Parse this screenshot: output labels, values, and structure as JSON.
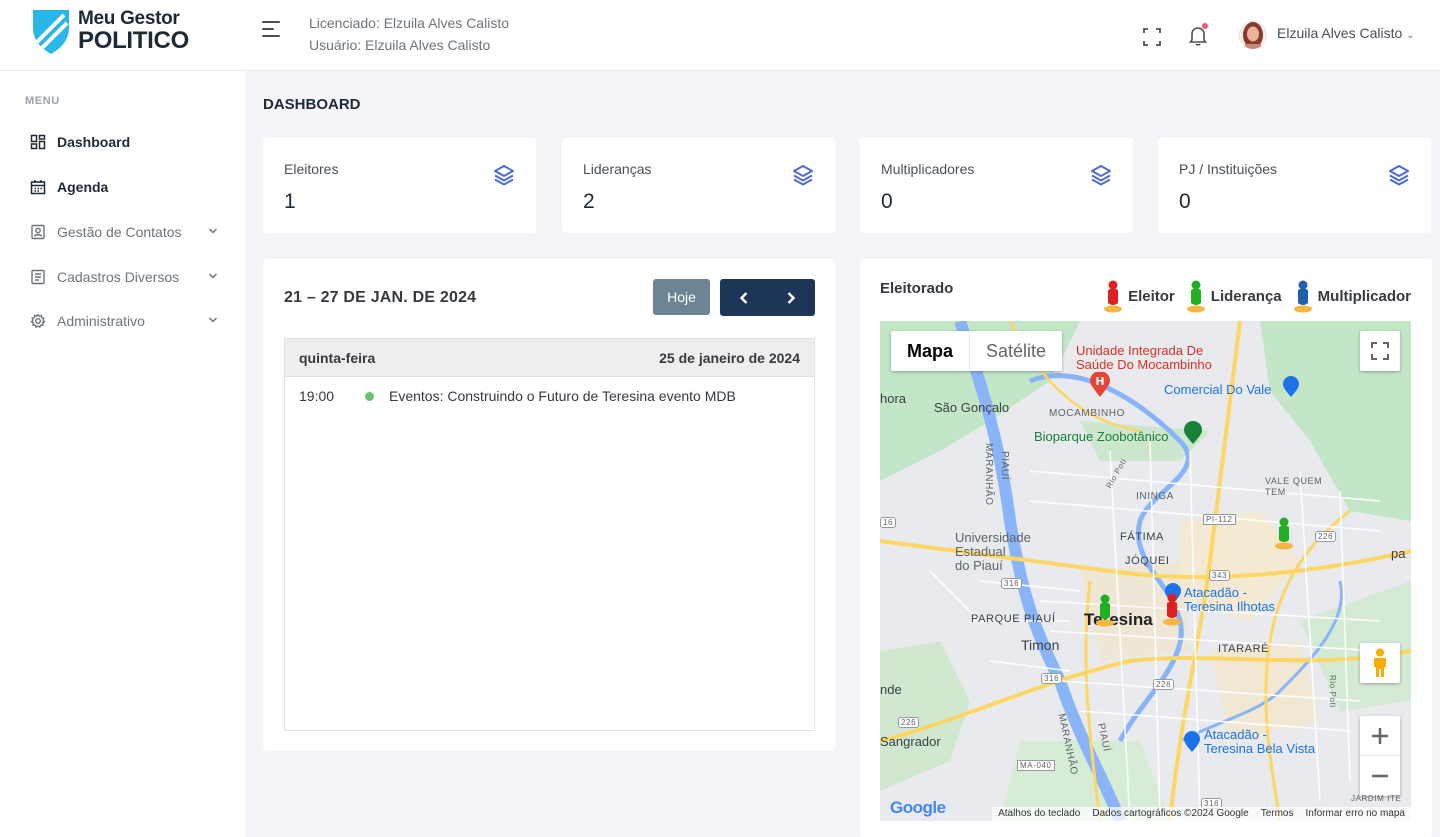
{
  "app": {
    "logo_line1": "Meu Gestor",
    "logo_line2": "POLITICO"
  },
  "header": {
    "licensee": "Licenciado: Elzuila Alves Calisto",
    "user_line": "Usuário: Elzuila Alves Calisto",
    "user_name": "Elzuila Alves Calisto"
  },
  "sidebar": {
    "menu_title": "MENU",
    "items": [
      {
        "label": "Dashboard",
        "icon": "dashboard-icon"
      },
      {
        "label": "Agenda",
        "icon": "calendar-icon"
      },
      {
        "label": "Gestão de Contatos",
        "icon": "contacts-icon"
      },
      {
        "label": "Cadastros Diversos",
        "icon": "form-icon"
      },
      {
        "label": "Administrativo",
        "icon": "gear-icon"
      }
    ]
  },
  "page": {
    "title": "DASHBOARD"
  },
  "stats": [
    {
      "label": "Eleitores",
      "value": "1"
    },
    {
      "label": "Lideranças",
      "value": "2"
    },
    {
      "label": "Multiplicadores",
      "value": "0"
    },
    {
      "label": "PJ / Instituições",
      "value": "0"
    }
  ],
  "calendar": {
    "range": "21 – 27 DE JAN. DE 2024",
    "today_label": "Hoje",
    "day_name": "quinta-feira",
    "day_date": "25 de janeiro de 2024",
    "events": [
      {
        "time": "19:00",
        "title": "Eventos: Construindo o Futuro de Teresina evento MDB"
      }
    ]
  },
  "map": {
    "title": "Eleitorado",
    "legend": [
      {
        "label": "Eleitor",
        "color": "#e02020"
      },
      {
        "label": "Liderança",
        "color": "#22b022"
      },
      {
        "label": "Multiplicador",
        "color": "#1f5fb0"
      }
    ],
    "type_map": "Mapa",
    "type_satellite": "Satélite",
    "labels": {
      "hospital": "Unidade Integrada De\nSaúde Do Mocambinho",
      "comercial": "Comercial Do Vale",
      "hora": "hora",
      "sao_goncalo": "São Gonçalo",
      "mocambinho": "MOCAMBINHO",
      "bioparque": "Bioparque Zoobotânico",
      "piaui1": "PIAUÍ",
      "maranhao1": "MARANHÃO",
      "rio_poti": "Rio Poti",
      "ininga": "ININGA",
      "vale_quem_tem": "VALE QUEM\nTEM",
      "pi112": "PI-112",
      "universidade": "Universidade\nEstadual\ndo Piauí",
      "fatima": "FÁTIMA",
      "joquei": "JÓQUEI",
      "r226a": "226",
      "r343": "343",
      "r316a": "316",
      "atacadao1": "Atacadão -\nTeresina Ilhotas",
      "parque_piaui": "PARQUE PIAUÍ",
      "teresina": "Teresina",
      "timon": "Timon",
      "itarare": "ITARARÉ",
      "r316b": "316",
      "r226b": "226",
      "nde": "nde",
      "r226c": "226",
      "sangrador": "Sangrador",
      "atacadao2": "Atacadão -\nTeresina Bela Vista",
      "ma040": "MA-040",
      "maranhao2": "MARANHÃO",
      "piaui2": "PIAUÍ",
      "rio_poti2": "Rio Poti",
      "jardim": "JARDIM ITE",
      "r316c": "316",
      "r16": "16",
      "pa": "pa"
    },
    "footer": [
      "Atalhos do teclado",
      "Dados cartográficos ©2024 Google",
      "Termos",
      "Informar erro no mapa"
    ],
    "google": "Google",
    "markers": [
      {
        "type": "Liderança",
        "color": "#22b022"
      },
      {
        "type": "Liderança",
        "color": "#22b022"
      },
      {
        "type": "Eleitor",
        "color": "#e02020"
      }
    ]
  }
}
